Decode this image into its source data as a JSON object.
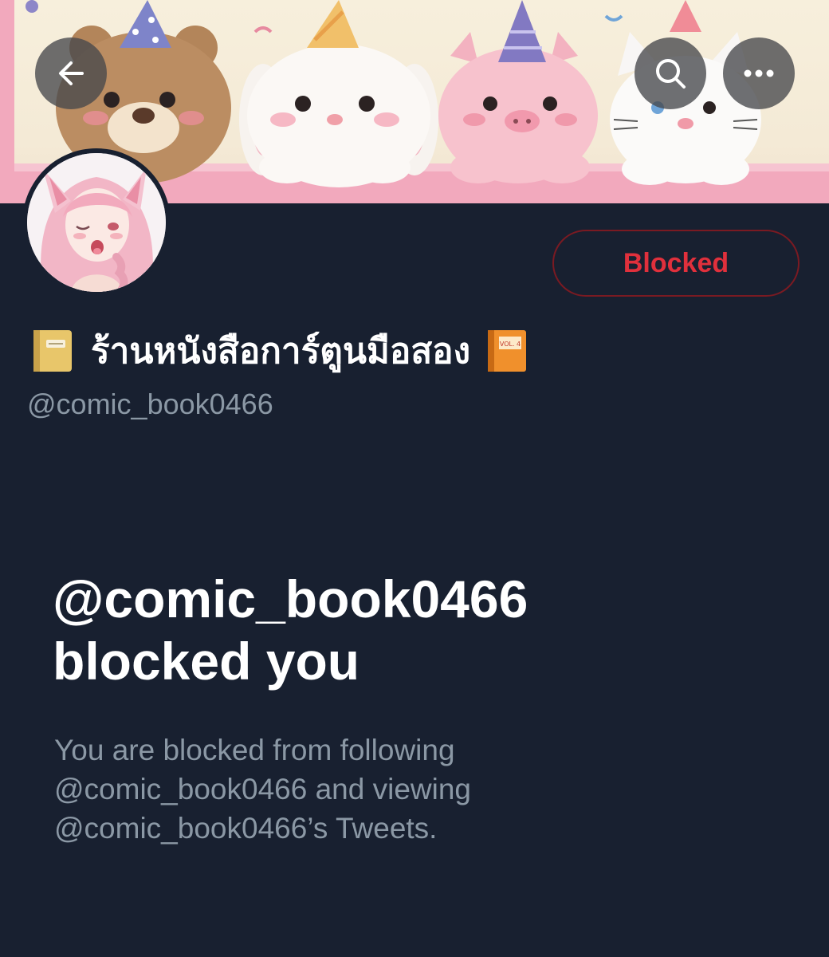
{
  "header": {
    "back_icon": "arrow-left-icon",
    "search_icon": "search-icon",
    "more_icon": "more-horizontal-icon"
  },
  "profile": {
    "display_name": "ร้านหนังสือการ์ตูนมือสอง",
    "leading_emoji": "notebook-icon",
    "trailing_emoji": "orange-book-icon",
    "trailing_emoji_text": "VOL. 4",
    "handle": "@comic_book0466",
    "action_button_label": "Blocked"
  },
  "blocked_notice": {
    "title_line1": "@comic_book0466",
    "title_line2": "blocked you",
    "description_line1": "You are blocked from following",
    "description_line2": "@comic_book0466 and viewing",
    "description_line3": "@comic_book0466’s Tweets."
  },
  "colors": {
    "background": "#182030",
    "blocked_text": "#e0303c",
    "blocked_border": "#7a1a22",
    "secondary_text": "#8b98a5",
    "primary_text": "#ffffff"
  }
}
